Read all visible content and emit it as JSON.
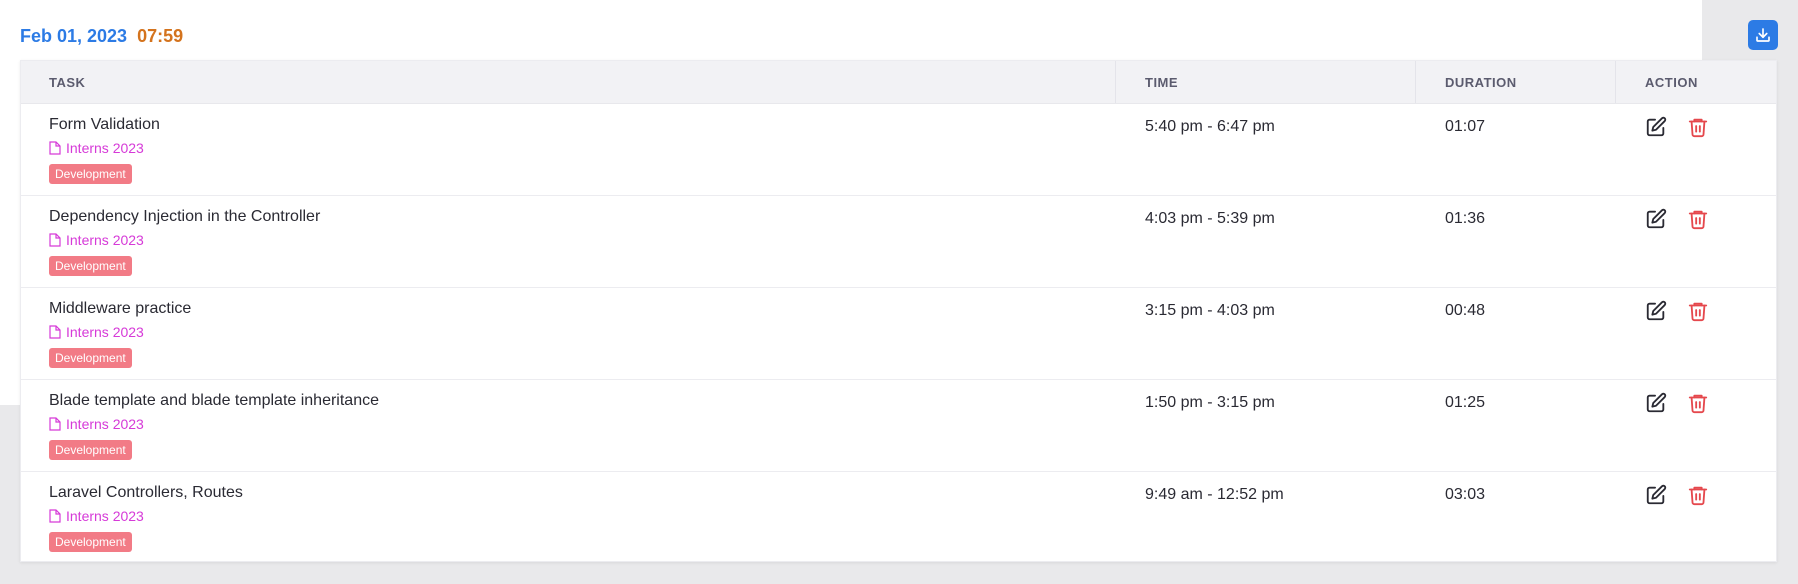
{
  "header": {
    "date": "Feb 01, 2023",
    "clock": "07:59",
    "download_icon": "download-icon"
  },
  "colors": {
    "date": "#2c7be5",
    "clock": "#d4731d",
    "project": "#d63ad8",
    "tag_bg": "#f27b86",
    "edit": "#2a2a33",
    "delete": "#e5484d",
    "download_bg": "#2c7be5"
  },
  "table": {
    "columns": [
      "TASK",
      "TIME",
      "DURATION",
      "ACTION"
    ],
    "rows": [
      {
        "title": "Form Validation",
        "project": "Interns 2023",
        "tag": "Development",
        "time": "5:40 pm - 6:47 pm",
        "duration": "01:07"
      },
      {
        "title": "Dependency Injection in the Controller",
        "project": "Interns 2023",
        "tag": "Development",
        "time": "4:03 pm - 5:39 pm",
        "duration": "01:36"
      },
      {
        "title": "Middleware practice",
        "project": "Interns 2023",
        "tag": "Development",
        "time": "3:15 pm - 4:03 pm",
        "duration": "00:48"
      },
      {
        "title": "Blade template and blade template inheritance",
        "project": "Interns 2023",
        "tag": "Development",
        "time": "1:50 pm - 3:15 pm",
        "duration": "01:25"
      },
      {
        "title": "Laravel Controllers, Routes",
        "project": "Interns 2023",
        "tag": "Development",
        "time": "9:49 am - 12:52 pm",
        "duration": "03:03"
      }
    ]
  }
}
